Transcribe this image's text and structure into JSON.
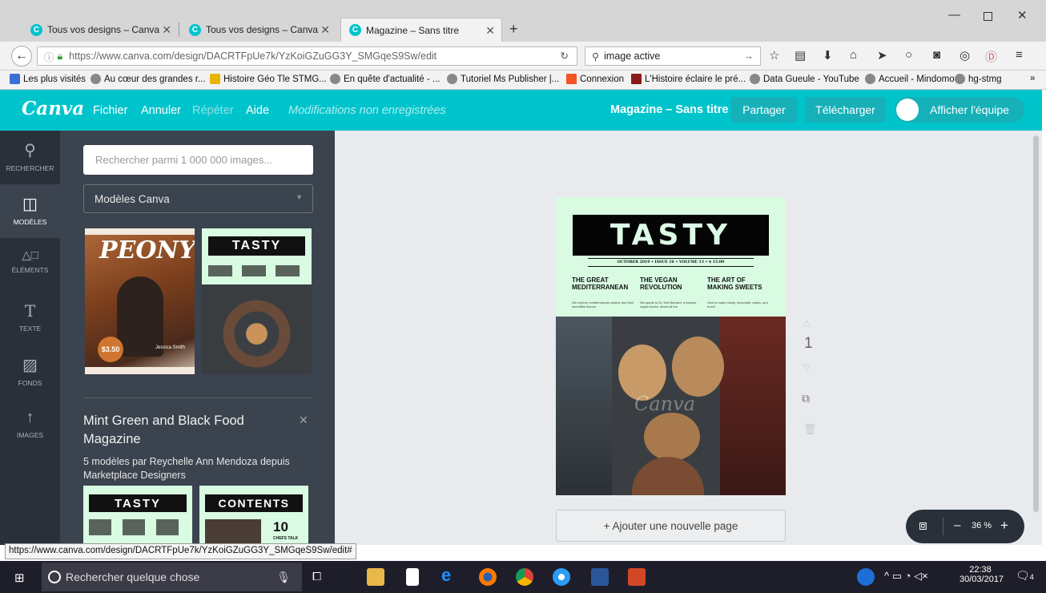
{
  "browser": {
    "tabs": [
      {
        "title": "Tous vos designs – Canva",
        "active": false
      },
      {
        "title": "Tous vos designs – Canva",
        "active": false
      },
      {
        "title": "Magazine – Sans titre",
        "active": true
      }
    ],
    "new_tab_label": "+",
    "url": "https://www.canva.com/design/DACRTFpUe7k/YzKoiGZuGG3Y_SMGqeS9Sw/edit",
    "url_domain": "canva.com",
    "search_value": "image active",
    "bookmarks": [
      "Les plus visités",
      "Au cœur des grandes r...",
      "Histoire Géo Tle STMG...",
      "En quête d'actualité - ...",
      "Tutoriel Ms Publisher |...",
      "Connexion",
      "L'Histoire éclaire le pré...",
      "Data Gueule - YouTube",
      "Accueil - Mindomo",
      "hg-stmg"
    ],
    "status_url": "https://www.canva.com/design/DACRTFpUe7k/YzKoiGZuGG3Y_SMGqeS9Sw/edit#"
  },
  "canva": {
    "logo": "Canva",
    "menu": {
      "file": "Fichier",
      "undo": "Annuler",
      "redo": "Répéter",
      "help": "Aide",
      "status": "Modifications non enregistrées"
    },
    "doc_title": "Magazine – Sans titre",
    "share": "Partager",
    "download": "Télécharger",
    "team": "Afficher l'équipe",
    "rail": [
      {
        "label": "RECHERCHER",
        "icon": "search-icon"
      },
      {
        "label": "MODÈLES",
        "icon": "layout-icon"
      },
      {
        "label": "ÉLÉMENTS",
        "icon": "shapes-icon"
      },
      {
        "label": "TEXTE",
        "icon": "text-icon"
      },
      {
        "label": "FONDS",
        "icon": "background-icon"
      },
      {
        "label": "IMAGES",
        "icon": "upload-icon"
      }
    ],
    "panel": {
      "search_placeholder": "Rechercher parmi 1 000 000 images...",
      "dropdown": "Modèles Canva",
      "thumb1_title": "PEONY",
      "thumb1_price": "$3.50",
      "thumb1_name": "Jessica Smith",
      "thumb2_title": "TASTY",
      "collection_title": "Mint Green and Black Food Magazine",
      "collection_sub": "5 modèles par Reychelle Ann Mendoza depuis Marketplace Designers",
      "mini1": "TASTY",
      "mini2": "CONTENTS",
      "mini2_num": "10",
      "mini2_sub": "CHEFS TALK"
    },
    "page": {
      "title": "TASTY",
      "issue": "OCTOBER 2019 • ISSUE 16 • VOLUME 13 • $ 15.00",
      "cols": [
        {
          "head": "THE GREAT MEDITERRANEAN",
          "text": "We explore mediterranean cuisine and their incredible flavors."
        },
        {
          "head": "THE VEGAN REVOLUTION",
          "text": "We speak to Dr. Neil Barnard, a famous vegan doctor, about all the"
        },
        {
          "head": "THE ART OF MAKING SWEETS",
          "text": "How to make candy, chocolate, cakes, and more!"
        }
      ],
      "watermark": "Canva",
      "page_number": "1"
    },
    "add_page": "+ Ajouter une nouvelle page",
    "zoom": "36 %",
    "zoom_minus": "–",
    "zoom_plus": "+"
  },
  "taskbar": {
    "search_placeholder": "Rechercher quelque chose",
    "time": "22:38",
    "date": "30/03/2017",
    "notif_count": "4"
  }
}
